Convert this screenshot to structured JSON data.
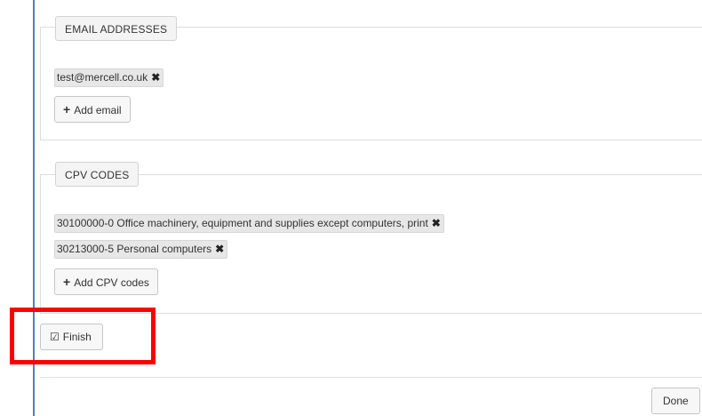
{
  "email_section": {
    "header": "EMAIL ADDRESSES",
    "tags": [
      {
        "label": "test@mercell.co.uk",
        "remove_icon": "times-icon"
      }
    ],
    "add_button": "Add email"
  },
  "cpv_section": {
    "header": "CPV CODES",
    "tags": [
      {
        "label": "30100000-0 Office machinery, equipment and supplies except computers, print",
        "remove_icon": "times-icon"
      },
      {
        "label": "30213000-5 Personal computers",
        "remove_icon": "times-icon"
      }
    ],
    "add_button": "Add CPV codes"
  },
  "finish_button": {
    "label": "Finish",
    "icon": "check-square-icon"
  },
  "done_button": {
    "label": "Done"
  },
  "colors": {
    "highlight": "#ff0000",
    "panel_border": "#4f7fc8"
  }
}
